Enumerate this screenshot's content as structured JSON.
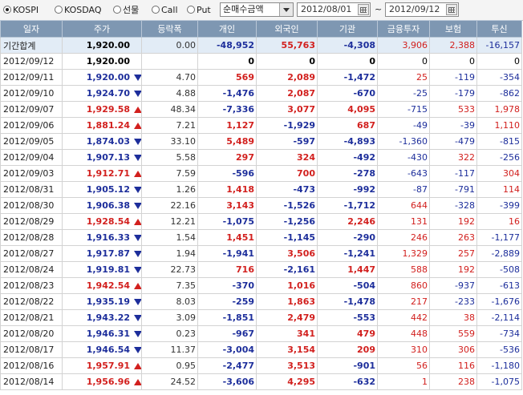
{
  "toolbar": {
    "radios": [
      {
        "label": "KOSPI",
        "selected": true
      },
      {
        "label": "KOSDAQ",
        "selected": false
      },
      {
        "label": "선물",
        "selected": false
      },
      {
        "label": "Call",
        "selected": false
      },
      {
        "label": "Put",
        "selected": false
      }
    ],
    "select_value": "순매수금액",
    "date_from": "2012/08/01",
    "tilde": "~",
    "date_to": "2012/09/12"
  },
  "table": {
    "headers": [
      "일자",
      "주가",
      "등락폭",
      "개인",
      "외국인",
      "기관",
      "금융투자",
      "보험",
      "투신"
    ],
    "rows": [
      {
        "date": "기간합계",
        "price": "1,920.00",
        "dir": "",
        "chg": "0.00",
        "ind": "-48,952",
        "for": "55,763",
        "inst": "-4,308",
        "fin": "3,906",
        "ins": "2,388",
        "trust": "-16,157",
        "sum": true
      },
      {
        "date": "2012/09/12",
        "price": "1,920.00",
        "dir": "",
        "chg": "",
        "ind": "0",
        "for": "0",
        "inst": "0",
        "fin": "0",
        "ins": "0",
        "trust": "0"
      },
      {
        "date": "2012/09/11",
        "price": "1,920.00",
        "dir": "down",
        "chg": "4.70",
        "ind": "569",
        "for": "2,089",
        "inst": "-1,472",
        "fin": "25",
        "ins": "-119",
        "trust": "-354"
      },
      {
        "date": "2012/09/10",
        "price": "1,924.70",
        "dir": "down",
        "chg": "4.88",
        "ind": "-1,476",
        "for": "2,087",
        "inst": "-670",
        "fin": "-25",
        "ins": "-179",
        "trust": "-862"
      },
      {
        "date": "2012/09/07",
        "price": "1,929.58",
        "dir": "up",
        "chg": "48.34",
        "ind": "-7,336",
        "for": "3,077",
        "inst": "4,095",
        "fin": "-715",
        "ins": "533",
        "trust": "1,978"
      },
      {
        "date": "2012/09/06",
        "price": "1,881.24",
        "dir": "up",
        "chg": "7.21",
        "ind": "1,127",
        "for": "-1,929",
        "inst": "687",
        "fin": "-49",
        "ins": "-39",
        "trust": "1,110"
      },
      {
        "date": "2012/09/05",
        "price": "1,874.03",
        "dir": "down",
        "chg": "33.10",
        "ind": "5,489",
        "for": "-597",
        "inst": "-4,893",
        "fin": "-1,360",
        "ins": "-479",
        "trust": "-815"
      },
      {
        "date": "2012/09/04",
        "price": "1,907.13",
        "dir": "down",
        "chg": "5.58",
        "ind": "297",
        "for": "324",
        "inst": "-492",
        "fin": "-430",
        "ins": "322",
        "trust": "-256"
      },
      {
        "date": "2012/09/03",
        "price": "1,912.71",
        "dir": "up",
        "chg": "7.59",
        "ind": "-596",
        "for": "700",
        "inst": "-278",
        "fin": "-643",
        "ins": "-117",
        "trust": "304"
      },
      {
        "date": "2012/08/31",
        "price": "1,905.12",
        "dir": "down",
        "chg": "1.26",
        "ind": "1,418",
        "for": "-473",
        "inst": "-992",
        "fin": "-87",
        "ins": "-791",
        "trust": "114"
      },
      {
        "date": "2012/08/30",
        "price": "1,906.38",
        "dir": "down",
        "chg": "22.16",
        "ind": "3,143",
        "for": "-1,526",
        "inst": "-1,712",
        "fin": "644",
        "ins": "-328",
        "trust": "-399"
      },
      {
        "date": "2012/08/29",
        "price": "1,928.54",
        "dir": "up",
        "chg": "12.21",
        "ind": "-1,075",
        "for": "-1,256",
        "inst": "2,246",
        "fin": "131",
        "ins": "192",
        "trust": "16"
      },
      {
        "date": "2012/08/28",
        "price": "1,916.33",
        "dir": "down",
        "chg": "1.54",
        "ind": "1,451",
        "for": "-1,145",
        "inst": "-290",
        "fin": "246",
        "ins": "263",
        "trust": "-1,177"
      },
      {
        "date": "2012/08/27",
        "price": "1,917.87",
        "dir": "down",
        "chg": "1.94",
        "ind": "-1,941",
        "for": "3,506",
        "inst": "-1,241",
        "fin": "1,329",
        "ins": "257",
        "trust": "-2,889"
      },
      {
        "date": "2012/08/24",
        "price": "1,919.81",
        "dir": "down",
        "chg": "22.73",
        "ind": "716",
        "for": "-2,161",
        "inst": "1,447",
        "fin": "588",
        "ins": "192",
        "trust": "-508"
      },
      {
        "date": "2012/08/23",
        "price": "1,942.54",
        "dir": "up",
        "chg": "7.35",
        "ind": "-370",
        "for": "1,016",
        "inst": "-504",
        "fin": "860",
        "ins": "-937",
        "trust": "-613"
      },
      {
        "date": "2012/08/22",
        "price": "1,935.19",
        "dir": "down",
        "chg": "8.03",
        "ind": "-259",
        "for": "1,863",
        "inst": "-1,478",
        "fin": "217",
        "ins": "-233",
        "trust": "-1,676"
      },
      {
        "date": "2012/08/21",
        "price": "1,943.22",
        "dir": "down",
        "chg": "3.09",
        "ind": "-1,851",
        "for": "2,479",
        "inst": "-553",
        "fin": "442",
        "ins": "38",
        "trust": "-2,114"
      },
      {
        "date": "2012/08/20",
        "price": "1,946.31",
        "dir": "down",
        "chg": "0.23",
        "ind": "-967",
        "for": "341",
        "inst": "479",
        "fin": "448",
        "ins": "559",
        "trust": "-734"
      },
      {
        "date": "2012/08/17",
        "price": "1,946.54",
        "dir": "down",
        "chg": "11.37",
        "ind": "-3,004",
        "for": "3,154",
        "inst": "209",
        "fin": "310",
        "ins": "306",
        "trust": "-536"
      },
      {
        "date": "2012/08/16",
        "price": "1,957.91",
        "dir": "up",
        "chg": "0.95",
        "ind": "-2,477",
        "for": "3,513",
        "inst": "-901",
        "fin": "56",
        "ins": "116",
        "trust": "-1,180"
      },
      {
        "date": "2012/08/14",
        "price": "1,956.96",
        "dir": "up",
        "chg": "24.52",
        "ind": "-3,606",
        "for": "4,295",
        "inst": "-632",
        "fin": "1",
        "ins": "238",
        "trust": "-1,075"
      }
    ]
  },
  "colors": {
    "up": "#d2201e",
    "down": "#1d2e9b",
    "header_bg": "#7e97b2",
    "sum_bg": "#e2ecf6"
  }
}
